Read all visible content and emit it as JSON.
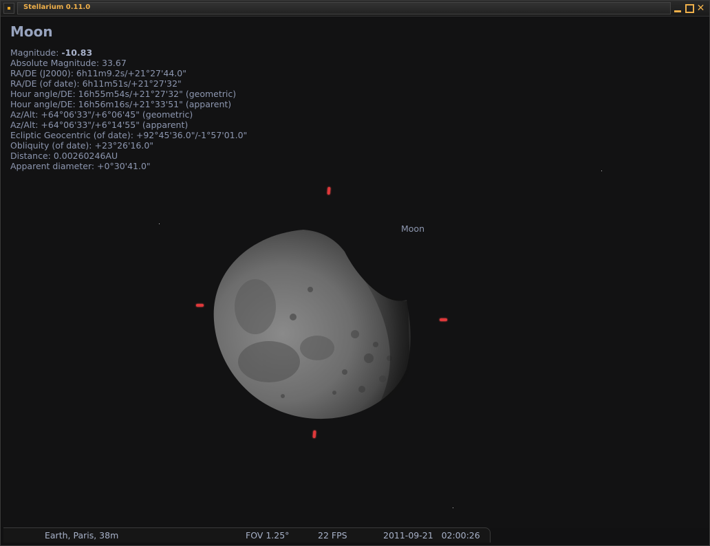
{
  "window": {
    "title": "Stellarium 0.11.0"
  },
  "object": {
    "name": "Moon",
    "sky_label": "Moon",
    "magnitude_label": "Magnitude: ",
    "magnitude_value": "-10.83",
    "details": [
      "Absolute Magnitude: 33.67",
      "RA/DE (J2000): 6h11m9.2s/+21°27'44.0\"",
      "RA/DE (of date): 6h11m51s/+21°27'32\"",
      "Hour angle/DE: 16h55m54s/+21°27'32\" (geometric)",
      "Hour angle/DE: 16h56m16s/+21°33'51\" (apparent)",
      "Az/Alt: +64°06'33\"/+6°06'45\" (geometric)",
      "Az/Alt: +64°06'33\"/+6°14'55\" (apparent)",
      "Ecliptic Geocentric (of date): +92°45'36.0\"/-1°57'01.0\"",
      "Obliquity (of date): +23°26'16.0\"",
      "Distance: 0.00260246AU",
      "Apparent diameter: +0°30'41.0\""
    ]
  },
  "status": {
    "location": "Earth, Paris, 38m",
    "fov": "FOV 1.25°",
    "fps": "22 FPS",
    "datetime": "2011-09-21   02:00:26"
  },
  "colors": {
    "title_accent": "#f0b04a",
    "info_text": "#8d97b0",
    "pointer": "#e0383a"
  }
}
